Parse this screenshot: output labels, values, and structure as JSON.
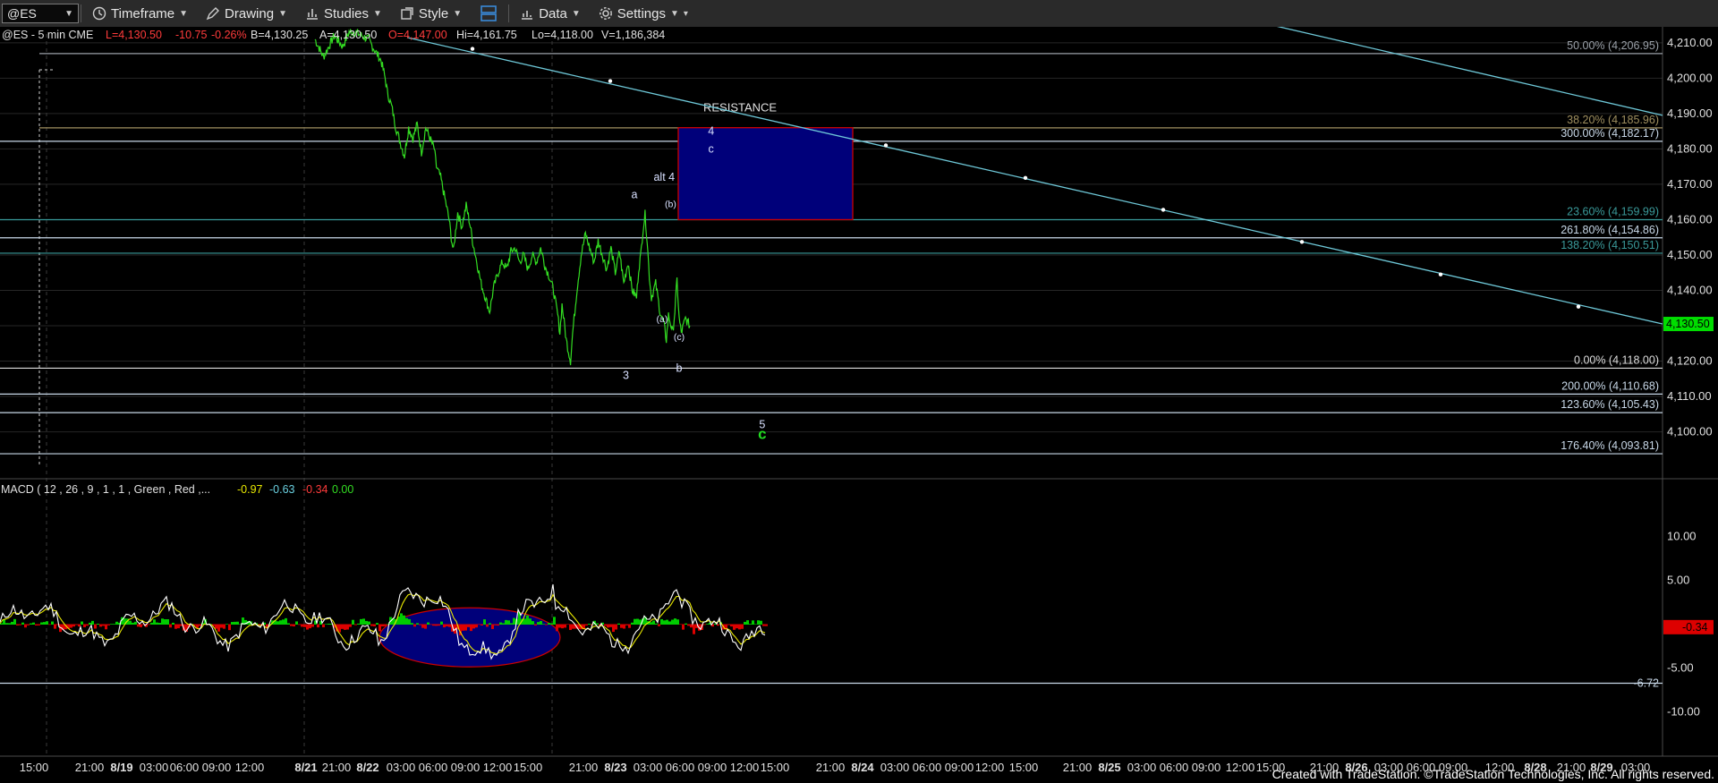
{
  "toolbar": {
    "symbol": "@ES",
    "timeframe": "Timeframe",
    "drawing": "Drawing",
    "studies": "Studies",
    "style": "Style",
    "data": "Data",
    "settings": "Settings"
  },
  "quote_header": {
    "symbol_info": "@ES - 5 min  CME",
    "last": "L=4,130.50",
    "change": "-10.75",
    "change_pct": "-0.26%",
    "bid": "B=4,130.25",
    "ask": "A=4,130.50",
    "open": "O=4,147.00",
    "high": "Hi=4,161.75",
    "low": "Lo=4,118.00",
    "volume": "V=1,186,384"
  },
  "macd_header": {
    "label": "MACD ( 12 , 26 , 9 , 1 , 1 , Green , Red ,...",
    "macd": "-0.97",
    "signal": "-0.63",
    "diff": "-0.34",
    "zero": "0.00"
  },
  "colors": {
    "price": "#33dd22",
    "trendline": "#6ec8d8",
    "level": "#9ab3c8",
    "box_fill": "#00007a",
    "box_border": "#cc0000",
    "macd_line": "#ffffff",
    "signal_line": "#e8e800",
    "hist_pos": "#00cc00",
    "hist_neg": "#dd0000",
    "last_price_tag": "#00dd00"
  },
  "chart_data": {
    "type": "line",
    "title": "@ES - 5 min",
    "price_axis": {
      "ticks": [
        "4,210.00",
        "4,200.00",
        "4,190.00",
        "4,180.00",
        "4,170.00",
        "4,160.00",
        "4,150.00",
        "4,140.00",
        "4,130.00",
        "4,120.00",
        "4,110.00",
        "4,100.00"
      ],
      "tick_values": [
        4210,
        4200,
        4190,
        4180,
        4170,
        4160,
        4150,
        4140,
        4130,
        4120,
        4110,
        4100
      ],
      "ylim": [
        4088,
        4213
      ],
      "last_price": 4130.5,
      "last_price_label": "4,130.50"
    },
    "time_axis": {
      "labels": [
        "15:00",
        "21:00",
        "8/19",
        "03:00",
        "06:00",
        "09:00",
        "12:00",
        "8/21",
        "21:00",
        "8/22",
        "03:00",
        "06:00",
        "09:00",
        "12:00",
        "15:00",
        "21:00",
        "8/23",
        "03:00",
        "06:00",
        "09:00",
        "12:00",
        "15:00",
        "21:00",
        "8/24",
        "03:00",
        "06:00",
        "09:00",
        "12:00",
        "15:00",
        "21:00",
        "8/25",
        "03:00",
        "06:00",
        "09:00",
        "12:00",
        "15:00",
        "21:00",
        "8/26",
        "03:00",
        "06:00",
        "09:00",
        "12:00",
        "8/28",
        "21:00",
        "8/29",
        "03:00"
      ],
      "bold": [
        "8/19",
        "8/21",
        "8/22",
        "8/23",
        "8/24",
        "8/25",
        "8/26",
        "8/28",
        "8/29"
      ]
    },
    "price_path": [
      [
        0,
        4211
      ],
      [
        4,
        4206
      ],
      [
        9,
        4212
      ],
      [
        13,
        4209
      ],
      [
        16,
        4213
      ],
      [
        19,
        4213
      ],
      [
        22,
        4212
      ],
      [
        25,
        4211
      ],
      [
        28,
        4208
      ],
      [
        31,
        4205
      ],
      [
        33,
        4200
      ],
      [
        34,
        4196
      ],
      [
        36,
        4192
      ],
      [
        38,
        4186
      ],
      [
        40,
        4182
      ],
      [
        42,
        4178
      ],
      [
        44,
        4186
      ],
      [
        46,
        4183
      ],
      [
        48,
        4187
      ],
      [
        50,
        4179
      ],
      [
        52,
        4186
      ],
      [
        54,
        4183
      ],
      [
        56,
        4180
      ],
      [
        57,
        4175
      ],
      [
        59,
        4172
      ],
      [
        61,
        4166
      ],
      [
        63,
        4160
      ],
      [
        64,
        4155
      ],
      [
        65,
        4151
      ],
      [
        67,
        4162
      ],
      [
        69,
        4158
      ],
      [
        71,
        4164
      ],
      [
        73,
        4158
      ],
      [
        74,
        4154
      ],
      [
        76,
        4148
      ],
      [
        78,
        4142
      ],
      [
        80,
        4138
      ],
      [
        82,
        4134
      ],
      [
        84,
        4141
      ],
      [
        86,
        4145
      ],
      [
        88,
        4148
      ],
      [
        90,
        4146
      ],
      [
        92,
        4151
      ],
      [
        94,
        4152
      ],
      [
        96,
        4148
      ],
      [
        98,
        4150
      ],
      [
        100,
        4146
      ],
      [
        102,
        4150
      ],
      [
        104,
        4148
      ],
      [
        106,
        4152
      ],
      [
        108,
        4147
      ],
      [
        110,
        4144
      ],
      [
        112,
        4140
      ],
      [
        114,
        4133
      ],
      [
        115,
        4128
      ],
      [
        116,
        4136
      ],
      [
        118,
        4126
      ],
      [
        120,
        4120
      ],
      [
        121,
        4128
      ],
      [
        123,
        4140
      ],
      [
        125,
        4150
      ],
      [
        127,
        4156
      ],
      [
        129,
        4152
      ],
      [
        131,
        4148
      ],
      [
        133,
        4154
      ],
      [
        135,
        4150
      ],
      [
        137,
        4146
      ],
      [
        139,
        4152
      ],
      [
        141,
        4145
      ],
      [
        143,
        4151
      ],
      [
        145,
        4142
      ],
      [
        147,
        4148
      ],
      [
        149,
        4140
      ],
      [
        151,
        4138
      ],
      [
        152,
        4146
      ],
      [
        153,
        4150
      ],
      [
        154,
        4157
      ],
      [
        155,
        4161.5
      ],
      [
        156,
        4154
      ],
      [
        157,
        4144
      ],
      [
        158,
        4138
      ],
      [
        160,
        4142
      ],
      [
        162,
        4134
      ],
      [
        164,
        4130
      ],
      [
        165,
        4126
      ],
      [
        166,
        4133
      ],
      [
        168,
        4128
      ],
      [
        169,
        4134
      ],
      [
        170,
        4143
      ],
      [
        171,
        4132
      ],
      [
        172,
        4128
      ],
      [
        174,
        4132
      ],
      [
        176,
        4130
      ]
    ],
    "fib_levels": [
      {
        "label": "50.00% (4,206.95)",
        "value": 4206.95,
        "color": "#9aa0a8"
      },
      {
        "label": "38.20% (4,185.96)",
        "value": 4185.96,
        "color": "#a09060"
      },
      {
        "label": "300.00% (4,182.17)",
        "value": 4182.17,
        "color": "#c8d8e8"
      },
      {
        "label": "23.60% (4,159.99)",
        "value": 4159.99,
        "color": "#3a9a9a"
      },
      {
        "label": "261.80% (4,154.86)",
        "value": 4154.86,
        "color": "#c8d8e8"
      },
      {
        "label": "138.20% (4,150.51)",
        "value": 4150.51,
        "color": "#3a9a9a"
      },
      {
        "label": "0.00% (4,118.00)",
        "value": 4118.0,
        "color": "#dddddd"
      },
      {
        "label": "200.00% (4,110.68)",
        "value": 4110.68,
        "color": "#c8d8e8"
      },
      {
        "label": "123.60% (4,105.43)",
        "value": 4105.43,
        "color": "#c8d8e8"
      },
      {
        "label": "176.40% (4,093.81)",
        "value": 4093.81,
        "color": "#c8d8e8"
      }
    ],
    "resistance_box": {
      "label": "RESISTANCE",
      "top": 4186,
      "bottom": 4160
    },
    "wave_labels": [
      {
        "text": "alt 4",
        "x": 164,
        "price": 4171
      },
      {
        "text": "4",
        "x": 186,
        "price": 4184
      },
      {
        "text": "c",
        "x": 186,
        "price": 4179
      },
      {
        "text": "a",
        "x": 150,
        "price": 4166
      },
      {
        "text": "(b)",
        "x": 167,
        "price": 4163.5
      },
      {
        "text": "(a)",
        "x": 163,
        "price": 4131
      },
      {
        "text": "(c)",
        "x": 171,
        "price": 4126
      },
      {
        "text": "3",
        "x": 146,
        "price": 4115
      },
      {
        "text": "b",
        "x": 171,
        "price": 4117
      },
      {
        "text": "5",
        "x": 210,
        "price": 4101
      },
      {
        "text": "c",
        "x": 210,
        "price": 4098,
        "green": true
      }
    ],
    "macd_axis": {
      "ticks": [
        "10.00",
        "5.00",
        "-5.00",
        "-10.00"
      ],
      "tick_values": [
        10,
        5,
        -5,
        -10
      ],
      "ylim": [
        -14,
        14
      ]
    },
    "macd_reference": {
      "label": "-6.72",
      "value": -6.72
    },
    "macd_last": {
      "label": "-0.34",
      "value": -0.34
    }
  },
  "footer": "Created with TradeStation. ©TradeStation Technologies, Inc. All rights reserved."
}
